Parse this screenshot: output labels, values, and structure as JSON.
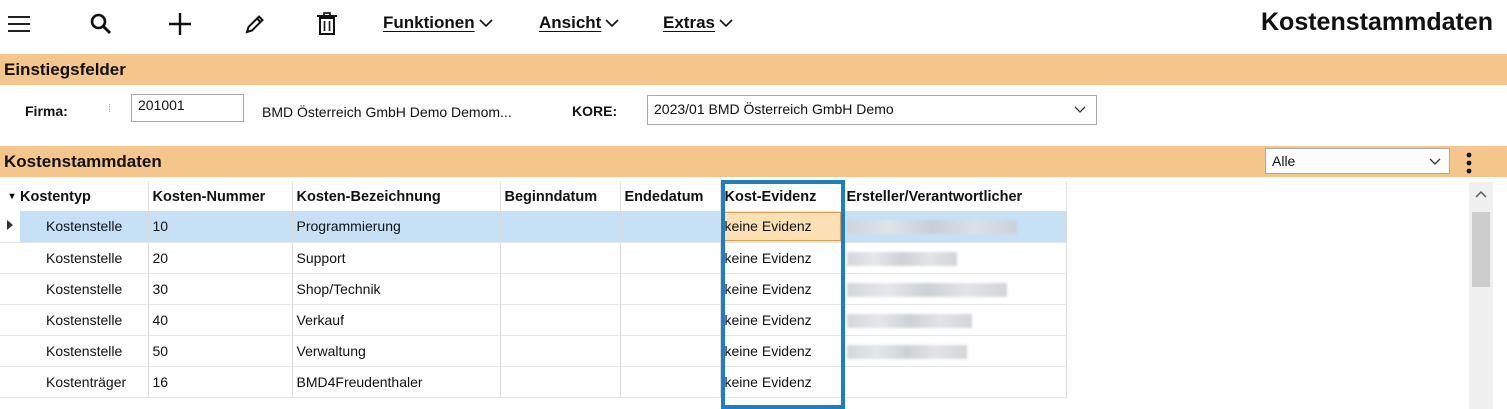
{
  "toolbar": {
    "icons": [
      "hamburger-icon",
      "search-icon",
      "plus-icon",
      "pencil-icon",
      "trash-icon"
    ],
    "menus": [
      {
        "label": "Funktionen"
      },
      {
        "label": "Ansicht"
      },
      {
        "label": "Extras"
      }
    ]
  },
  "page_title": "Kostenstammdaten",
  "einstieg": {
    "section_title": "Einstiegsfelder",
    "firma_label": "Firma:",
    "firma_value": "201001",
    "firma_name": "BMD Österreich GmbH Demo Demom...",
    "kore_label": "KORE:",
    "kore_value": "2023/01 BMD Österreich GmbH Demo"
  },
  "kosten": {
    "section_title": "Kostenstammdaten",
    "filter_value": "Alle",
    "columns": [
      "Kostentyp",
      "Kosten-Nummer",
      "Kosten-Bezeichnung",
      "Beginndatum",
      "Endedatum",
      "Kost-Evidenz",
      "Ersteller/Verantwortlicher"
    ],
    "rows": [
      {
        "typ": "Kostenstelle",
        "nummer": "10",
        "bezeichnung": "Programmierung",
        "beginn": "",
        "ende": "",
        "evidenz": "keine Evidenz"
      },
      {
        "typ": "Kostenstelle",
        "nummer": "20",
        "bezeichnung": "Support",
        "beginn": "",
        "ende": "",
        "evidenz": "keine Evidenz"
      },
      {
        "typ": "Kostenstelle",
        "nummer": "30",
        "bezeichnung": "Shop/Technik",
        "beginn": "",
        "ende": "",
        "evidenz": "keine Evidenz"
      },
      {
        "typ": "Kostenstelle",
        "nummer": "40",
        "bezeichnung": "Verkauf",
        "beginn": "",
        "ende": "",
        "evidenz": "keine Evidenz"
      },
      {
        "typ": "Kostenstelle",
        "nummer": "50",
        "bezeichnung": "Verwaltung",
        "beginn": "",
        "ende": "",
        "evidenz": "keine Evidenz"
      },
      {
        "typ": "Kostenträger",
        "nummer": "16",
        "bezeichnung": "BMD4Freudenthaler",
        "beginn": "",
        "ende": "",
        "evidenz": "keine Evidenz"
      }
    ]
  },
  "colors": {
    "section_bg": "#f5c68c",
    "selected_row": "#c6e1f6",
    "highlight_border": "#1a7fc5"
  }
}
